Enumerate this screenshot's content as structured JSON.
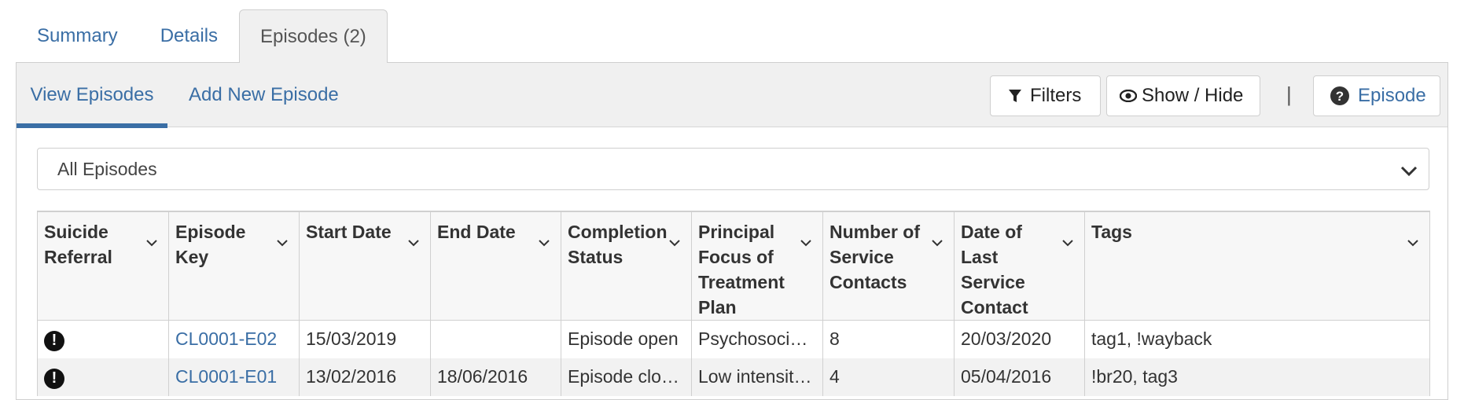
{
  "top_tabs": [
    {
      "label": "Summary",
      "active": false
    },
    {
      "label": "Details",
      "active": false
    },
    {
      "label": "Episodes (2)",
      "active": true
    }
  ],
  "sub_tabs": {
    "view": "View Episodes",
    "add": "Add New Episode"
  },
  "toolbar": {
    "filters_label": "Filters",
    "showhide_label": "Show / Hide",
    "separator": "|",
    "episode_label": "Episode"
  },
  "filter_select": {
    "value": "All Episodes"
  },
  "table": {
    "columns": [
      "Suicide Referral",
      "Episode Key",
      "Start Date",
      "End Date",
      "Completion Status",
      "Principal Focus of Treatment Plan",
      "Number of Service Contacts",
      "Date of Last Service Contact",
      "Tags"
    ],
    "rows": [
      {
        "suicide_flag": "!",
        "episode_key": "CL0001-E02",
        "start_date": "15/03/2019",
        "end_date": "",
        "completion_status": "Episode open",
        "principal_focus": "Psychosocial Support",
        "service_contacts": "8",
        "last_contact": "20/03/2020",
        "tags": "tag1, !wayback"
      },
      {
        "suicide_flag": "!",
        "episode_key": "CL0001-E01",
        "start_date": "13/02/2016",
        "end_date": "18/06/2016",
        "completion_status": "Episode closed - treatment concluded",
        "principal_focus": "Low intensity psychological intervention",
        "service_contacts": "4",
        "last_contact": "05/04/2016",
        "tags": "!br20, tag3"
      }
    ]
  },
  "colors": {
    "link": "#3a6ea5",
    "tab_bg": "#f0f0f0",
    "border": "#cfcfcf"
  },
  "icons": [
    "filter-icon",
    "eye-icon",
    "help-icon",
    "chevron-down-icon",
    "alert-icon"
  ]
}
